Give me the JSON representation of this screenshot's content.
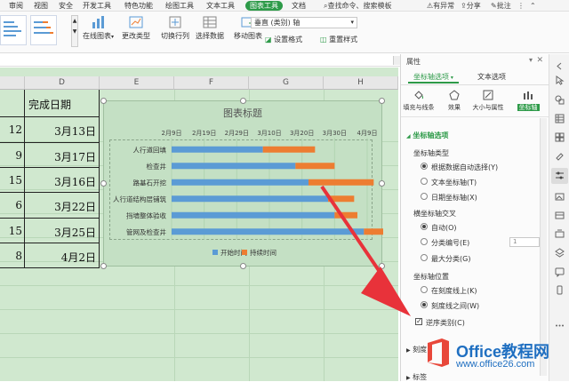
{
  "menu": {
    "tabs": [
      "审阅",
      "视图",
      "安全",
      "开发工具",
      "特色功能",
      "绘图工具",
      "文本工具",
      "图表工具",
      "文档"
    ],
    "active": "图表工具",
    "search": "查找命令、搜索模板",
    "right_items": [
      "有异常",
      "分享",
      "批注"
    ]
  },
  "ribbon": {
    "online_chart": "在线图表",
    "change_type": "更改类型",
    "switch_row_col": "切换行列",
    "select_data": "选择数据",
    "move_chart": "移动图表",
    "axis_combo": "垂直 (类别) 轴",
    "set_format": "设置格式",
    "reset_style": "重置样式"
  },
  "sheet": {
    "columns": [
      "D",
      "E",
      "F",
      "G",
      "H"
    ],
    "header_D": "完成日期",
    "rows": [
      {
        "c": "12",
        "d": "3月13日"
      },
      {
        "c": "9",
        "d": "3月17日"
      },
      {
        "c": "15",
        "d": "3月16日"
      },
      {
        "c": "6",
        "d": "3月22日"
      },
      {
        "c": "15",
        "d": "3月25日"
      },
      {
        "c": "8",
        "d": "4月2日"
      }
    ]
  },
  "chart_data": {
    "type": "bar",
    "title": "图表标题",
    "x_ticks": [
      "2月9日",
      "2月19日",
      "2月29日",
      "3月10日",
      "3月20日",
      "3月30日",
      "4月9日"
    ],
    "categories": [
      "人行道回填",
      "检查井",
      "路基石开挖",
      "人行道结构层铺筑",
      "挡墙整体验收",
      "管网及检查井"
    ],
    "series": [
      {
        "name": "开始时间",
        "start_offset_days": [
          0,
          0,
          0,
          0,
          0,
          0
        ],
        "values": [
          28,
          38,
          42,
          48,
          50,
          59
        ]
      },
      {
        "name": "持续时间",
        "values": [
          16,
          12,
          20,
          8,
          7,
          11
        ]
      }
    ],
    "legend": "bottom",
    "colors": {
      "start": "#5b9bd5",
      "duration": "#ed7d31"
    }
  },
  "panel": {
    "title": "属性",
    "tab_axis_options": "坐标轴选项",
    "tab_text_options": "文本选项",
    "icons": [
      "填充与线条",
      "效果",
      "大小与属性",
      "坐标轴"
    ],
    "section_axis_options": "坐标轴选项",
    "axis_type_label": "坐标轴类型",
    "axis_type_options": [
      "根据数据自动选择(Y)",
      "文本坐标轴(T)",
      "日期坐标轴(X)"
    ],
    "cross_label": "横坐标轴交叉",
    "cross_options": [
      "自动(O)",
      "分类编号(E)",
      "最大分类(G)"
    ],
    "cross_value": "1",
    "position_label": "坐标轴位置",
    "position_options": [
      "在刻度线上(K)",
      "刻度线之间(W)"
    ],
    "reverse_label": "逆序类别(C)",
    "collapsed_1": "刻度",
    "collapsed_2": "标签"
  },
  "watermark": {
    "brand": "Office教程网",
    "url": "www.office26.com"
  }
}
